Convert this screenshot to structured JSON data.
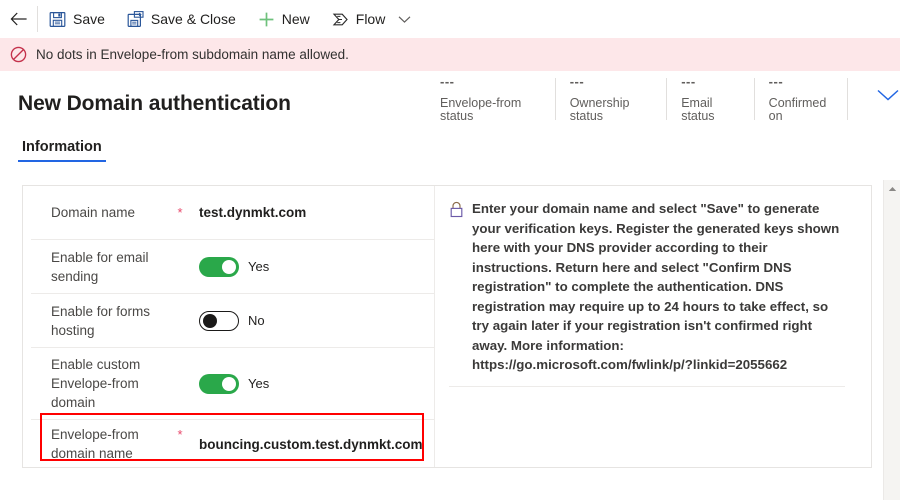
{
  "commandbar": {
    "back_label": "Back",
    "items": [
      {
        "label": "Save",
        "icon": "save-icon"
      },
      {
        "label": "Save & Close",
        "icon": "save-and-close-icon"
      },
      {
        "label": "New",
        "icon": "plus-icon"
      },
      {
        "label": "Flow",
        "icon": "flow-icon"
      }
    ],
    "overflow_icon": "chevron-down-icon"
  },
  "notification": {
    "icon": "blocked-icon",
    "message": "No dots in Envelope-from subdomain name allowed.",
    "background": "#fde7e9"
  },
  "header": {
    "title": "New Domain authentication",
    "expand_icon": "chevron-down-icon",
    "status_cells": [
      {
        "value": "---",
        "label": "Envelope-from status"
      },
      {
        "value": "---",
        "label": "Ownership status"
      },
      {
        "value": "---",
        "label": "Email status"
      },
      {
        "value": "---",
        "label": "Confirmed on"
      }
    ]
  },
  "tabs": [
    {
      "label": "Information",
      "active": true
    }
  ],
  "form": {
    "rows": [
      {
        "label": "Domain name",
        "required": "*",
        "type": "text",
        "value": "test.dynmkt.com"
      },
      {
        "label": "Enable for email sending",
        "required": "",
        "type": "toggle",
        "state": "on",
        "value": "Yes"
      },
      {
        "label": "Enable for forms hosting",
        "required": "",
        "type": "toggle",
        "state": "off",
        "value": "No"
      },
      {
        "label": "Enable custom Envelope-from domain",
        "required": "",
        "type": "toggle",
        "state": "on",
        "value": "Yes"
      },
      {
        "label": "Envelope-from domain name",
        "required": "*",
        "type": "text",
        "value": "bouncing.custom.test.dynmkt.com",
        "highlighted": true
      }
    ]
  },
  "info_panel": {
    "icon": "lock-icon",
    "text": "Enter your domain name and select \"Save\" to generate your verification keys. Register the generated keys shown here with your DNS provider according to their instructions. Return here and select \"Confirm DNS registration\" to complete the authentication. DNS registration may require up to 24 hours to take effect, so try again later if your registration isn't confirmed right away. More information: https://go.microsoft.com/fwlink/p/?linkid=2055662"
  },
  "scrollbar": {
    "up_icon": "scroll-up-icon"
  },
  "colors": {
    "accent": "#2266e3",
    "toggle_on": "#2aa84a",
    "error_bg": "#fde7e9",
    "required": "#e8486b",
    "highlight": "#ff0000"
  }
}
